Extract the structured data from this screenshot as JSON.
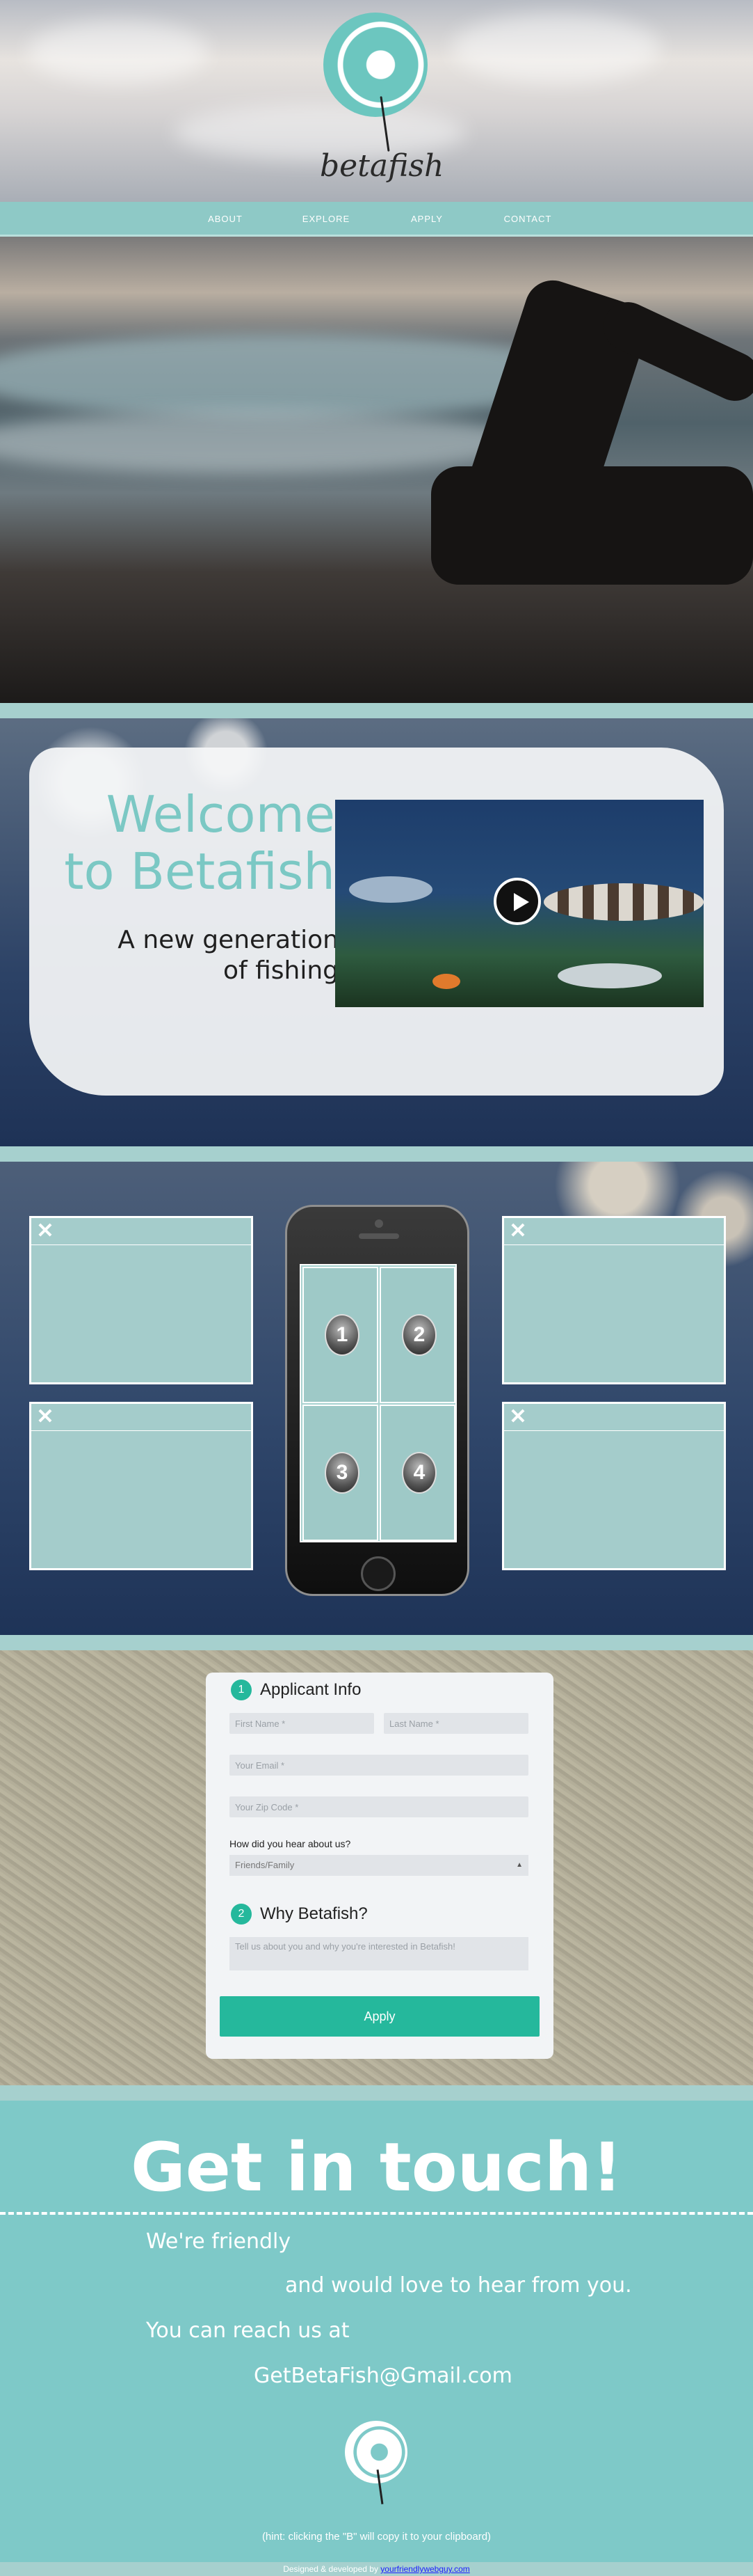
{
  "brand": {
    "name": "betafish"
  },
  "nav": [
    {
      "label": "ABOUT"
    },
    {
      "label": "EXPLORE"
    },
    {
      "label": "APPLY"
    },
    {
      "label": "CONTACT"
    }
  ],
  "welcome": {
    "title_line1": "Welcome",
    "title_line2": "to Betafish",
    "sub_line1": "A new generation",
    "sub_line2": "of fishing"
  },
  "explore": {
    "close_glyph": "✕",
    "tiles": [
      "1",
      "2",
      "3",
      "4"
    ]
  },
  "apply": {
    "step1": {
      "number": "1",
      "title": "Applicant Info"
    },
    "first_name_placeholder": "First Name *",
    "last_name_placeholder": "Last Name *",
    "email_placeholder": "Your Email *",
    "zip_placeholder": "Your Zip Code *",
    "how_label": "How did you hear about us?",
    "how_selected": "Friends/Family",
    "step2": {
      "number": "2",
      "title": "Why Betafish?"
    },
    "why_placeholder": "Tell us about you and why you're interested in Betafish!",
    "button_label": "Apply"
  },
  "contact": {
    "title": "Get in touch!",
    "line1": "We're friendly",
    "line2": "and would love to hear from you.",
    "line3": "You can reach us at",
    "email": "GetBetaFish@Gmail.com",
    "hint": "(hint: clicking the \"B\" will copy it to your clipboard)"
  },
  "footer": {
    "text": "Designed & developed by",
    "link": "yourfriendlywebguy.com"
  }
}
